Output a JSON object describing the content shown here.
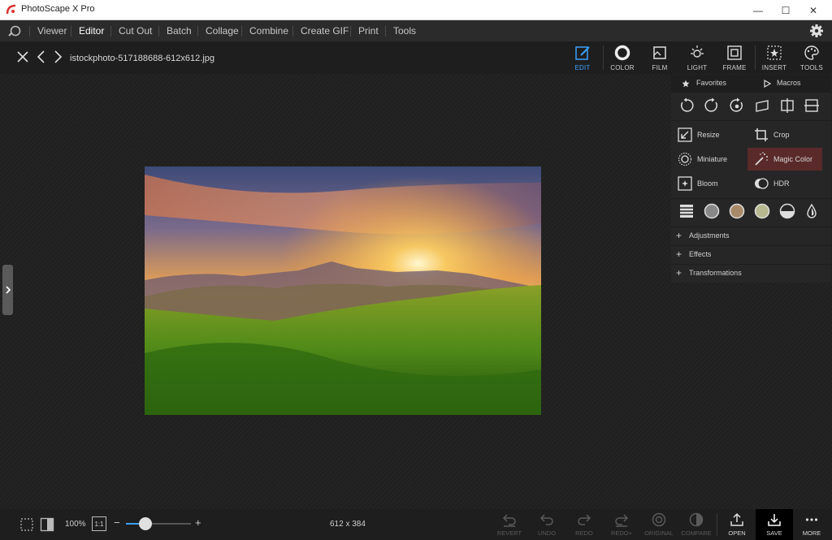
{
  "window": {
    "title": "PhotoScape X Pro",
    "minimize": "—",
    "maximize": "☐",
    "close": "✕"
  },
  "menu": {
    "items": [
      "Viewer",
      "Editor",
      "Cut Out",
      "Batch",
      "Collage",
      "Combine",
      "Create GIF",
      "Print",
      "Tools"
    ],
    "active": "Editor"
  },
  "toolbar": {
    "filename": "istockphoto-517188688-612x612.jpg",
    "tabs": [
      "EDIT",
      "COLOR",
      "FILM",
      "LIGHT",
      "FRAME",
      "INSERT",
      "TOOLS"
    ],
    "active_tab": "EDIT",
    "accent": "#3aa0ff"
  },
  "panel": {
    "favorites_label": "Favorites",
    "macros_label": "Macros",
    "tools": [
      "Resize",
      "Crop",
      "Miniature",
      "Magic Color",
      "Bloom",
      "HDR"
    ],
    "highlighted_tool": "Magic Color",
    "sections": [
      "Adjustments",
      "Effects",
      "Transformations"
    ]
  },
  "status": {
    "zoom": "100%",
    "one_to_one": "1:1",
    "dimensions": "612 x 384",
    "zoom_slider_fraction": 0.3,
    "buttons": [
      "REVERT",
      "UNDO",
      "REDO",
      "REDO+",
      "ORIGINAL",
      "COMPARE",
      "OPEN",
      "SAVE",
      "MORE"
    ]
  }
}
